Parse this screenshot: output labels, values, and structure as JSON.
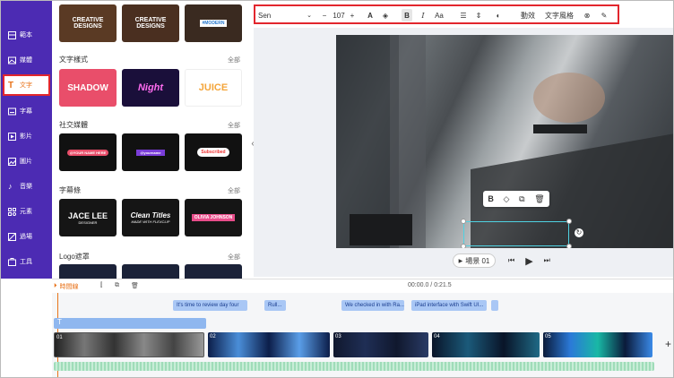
{
  "sidebar": {
    "items": [
      {
        "label": "範本",
        "icon": "template-icon"
      },
      {
        "label": "媒體",
        "icon": "media-icon"
      },
      {
        "label": "文字",
        "icon": "text-icon",
        "active": true
      },
      {
        "label": "字幕",
        "icon": "subtitle-icon"
      },
      {
        "label": "影片",
        "icon": "video-icon"
      },
      {
        "label": "圖片",
        "icon": "image-icon"
      },
      {
        "label": "音樂",
        "icon": "music-icon"
      },
      {
        "label": "元素",
        "icon": "elements-icon"
      },
      {
        "label": "過場",
        "icon": "transition-icon"
      },
      {
        "label": "工具",
        "icon": "tools-icon"
      }
    ]
  },
  "library": {
    "top_row": [
      "CREATIVE DESIGNS",
      "CREATIVE DESIGNS",
      "#MODERN"
    ],
    "sections": [
      {
        "title": "文字樣式",
        "all": "全部",
        "thumbs": [
          "SHADOW",
          "Night",
          "JUICE"
        ]
      },
      {
        "title": "社交媒體",
        "all": "全部",
        "thumbs": [
          "@YOUR NAME HERE",
          "@yourname",
          "Subscribed"
        ]
      },
      {
        "title": "字幕條",
        "all": "全部",
        "thumbs": [
          "JACE LEE",
          "Clean Titles",
          "OLIVIA JOHNSON"
        ]
      },
      {
        "title": "Logo遮罩",
        "all": "全部",
        "thumbs": [
          "",
          "",
          ""
        ]
      }
    ],
    "thumb_sub": {
      "jace": "DESIGNER",
      "clean": "MADE WITH FLEXCLIP"
    }
  },
  "toolbar": {
    "font": "Sen",
    "size": "107",
    "minus": "−",
    "plus": "+",
    "animation": "動效",
    "text_style": "文字風格",
    "case": "Aa"
  },
  "player": {
    "scene": "場景 01",
    "time": "00:00.0 / 0:21.5"
  },
  "timeline": {
    "time_dot_label": "時間線",
    "subtitles": [
      "It's time to review day four",
      "Rull...",
      "We checked in with Ra...",
      "iPad interface with Swift UI..."
    ],
    "clips": [
      "01",
      "02",
      "03",
      "04",
      "05"
    ]
  },
  "colors": {
    "sidebar": "#4c2bb3",
    "highlight": "#e2262d",
    "accent": "#e8731a",
    "selection": "#4fd2e2"
  }
}
